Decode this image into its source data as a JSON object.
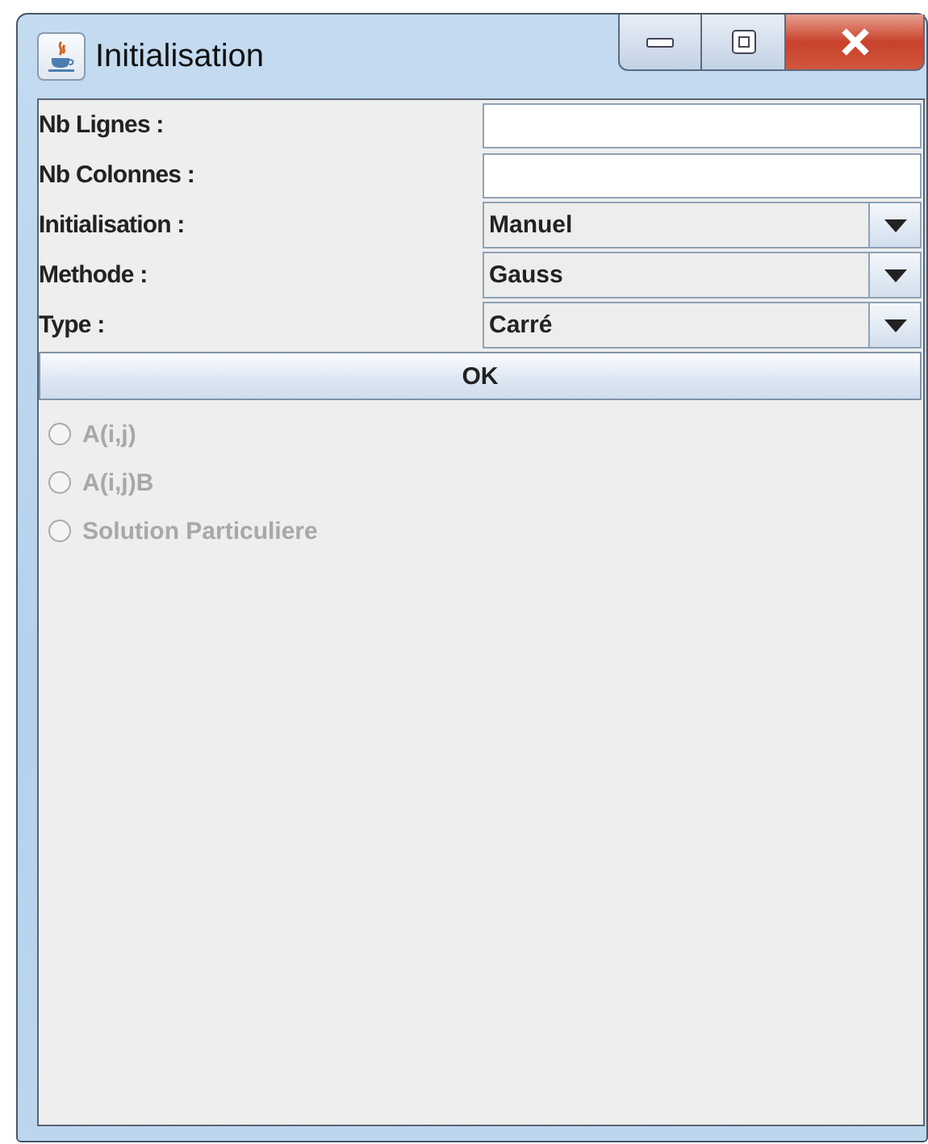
{
  "window": {
    "title": "Initialisation"
  },
  "fields": [
    {
      "label": "Nb Lignes :",
      "kind": "text"
    },
    {
      "label": "Nb Colonnes :",
      "kind": "text"
    },
    {
      "label": "Initialisation :",
      "kind": "combo",
      "value": "Manuel"
    },
    {
      "label": "Methode :",
      "kind": "combo",
      "value": "Gauss"
    },
    {
      "label": "Type :",
      "kind": "combo",
      "value": "Carré"
    }
  ],
  "button": "OK",
  "options": [
    {
      "label": "A(i,j)",
      "selected": false,
      "disabled": true
    },
    {
      "label": "A(i,j)B",
      "selected": false,
      "disabled": true
    },
    {
      "label": "Solution Particuliere",
      "selected": false,
      "disabled": true
    }
  ]
}
